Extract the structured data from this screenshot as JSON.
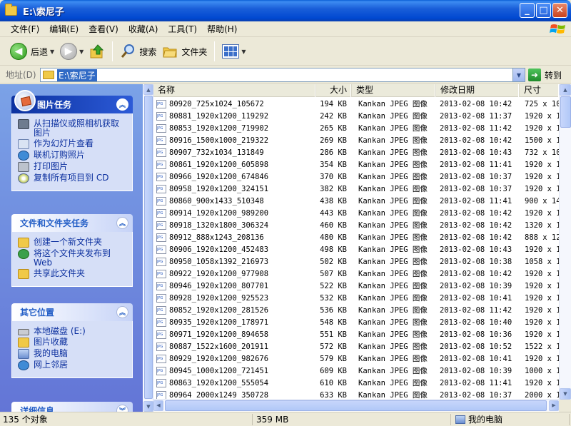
{
  "window": {
    "title": "E:\\索尼子"
  },
  "menu": [
    "文件(F)",
    "编辑(E)",
    "查看(V)",
    "收藏(A)",
    "工具(T)",
    "帮助(H)"
  ],
  "toolbar": {
    "back_label": "后退",
    "search_label": "搜索",
    "folders_label": "文件夹"
  },
  "address": {
    "label": "地址(D)",
    "path": "E:\\索尼子",
    "go_label": "转到"
  },
  "taskpane": {
    "picture_tasks": {
      "title": "图片任务",
      "items": [
        "从扫描仪或照相机获取图片",
        "作为幻灯片查看",
        "联机订购照片",
        "打印图片",
        "复制所有项目到 CD"
      ]
    },
    "file_tasks": {
      "title": "文件和文件夹任务",
      "items": [
        "创建一个新文件夹",
        "将这个文件夹发布到 Web",
        "共享此文件夹"
      ]
    },
    "other_places": {
      "title": "其它位置",
      "items": [
        "本地磁盘 (E:)",
        "图片收藏",
        "我的电脑",
        "网上邻居"
      ]
    },
    "details": {
      "title": "详细信息"
    }
  },
  "columns": {
    "name": "名称",
    "size": "大小",
    "type": "类型",
    "date": "修改日期",
    "dim": "尺寸"
  },
  "files": [
    {
      "name": "80920_725x1024_105672",
      "size": "194 KB",
      "type": "Kankan JPEG 图像",
      "date": "2013-02-08 10:42",
      "dim": "725 x 10"
    },
    {
      "name": "80881_1920x1200_119292",
      "size": "242 KB",
      "type": "Kankan JPEG 图像",
      "date": "2013-02-08 11:37",
      "dim": "1920 x 1"
    },
    {
      "name": "80853_1920x1200_719902",
      "size": "265 KB",
      "type": "Kankan JPEG 图像",
      "date": "2013-02-08 11:42",
      "dim": "1920 x 1"
    },
    {
      "name": "80916_1500x1000_219322",
      "size": "269 KB",
      "type": "Kankan JPEG 图像",
      "date": "2013-02-08 10:42",
      "dim": "1500 x 1"
    },
    {
      "name": "80907_732x1034_131849",
      "size": "286 KB",
      "type": "Kankan JPEG 图像",
      "date": "2013-02-08 10:43",
      "dim": "732 x 10"
    },
    {
      "name": "80861_1920x1200_605898",
      "size": "354 KB",
      "type": "Kankan JPEG 图像",
      "date": "2013-02-08 11:41",
      "dim": "1920 x 1"
    },
    {
      "name": "80966_1920x1200_674846",
      "size": "370 KB",
      "type": "Kankan JPEG 图像",
      "date": "2013-02-08 10:37",
      "dim": "1920 x 1"
    },
    {
      "name": "80958_1920x1200_324151",
      "size": "382 KB",
      "type": "Kankan JPEG 图像",
      "date": "2013-02-08 10:37",
      "dim": "1920 x 1"
    },
    {
      "name": "80860_900x1433_510348",
      "size": "438 KB",
      "type": "Kankan JPEG 图像",
      "date": "2013-02-08 11:41",
      "dim": "900 x 14"
    },
    {
      "name": "80914_1920x1200_989200",
      "size": "443 KB",
      "type": "Kankan JPEG 图像",
      "date": "2013-02-08 10:42",
      "dim": "1920 x 1"
    },
    {
      "name": "80918_1320x1800_306324",
      "size": "460 KB",
      "type": "Kankan JPEG 图像",
      "date": "2013-02-08 10:42",
      "dim": "1320 x 1"
    },
    {
      "name": "80912_888x1243_208136",
      "size": "480 KB",
      "type": "Kankan JPEG 图像",
      "date": "2013-02-08 10:42",
      "dim": "888 x 12"
    },
    {
      "name": "80906_1920x1200_452483",
      "size": "498 KB",
      "type": "Kankan JPEG 图像",
      "date": "2013-02-08 10:43",
      "dim": "1920 x 1"
    },
    {
      "name": "80950_1058x1392_216973",
      "size": "502 KB",
      "type": "Kankan JPEG 图像",
      "date": "2013-02-08 10:38",
      "dim": "1058 x 1"
    },
    {
      "name": "80922_1920x1200_977908",
      "size": "507 KB",
      "type": "Kankan JPEG 图像",
      "date": "2013-02-08 10:42",
      "dim": "1920 x 1"
    },
    {
      "name": "80946_1920x1200_807701",
      "size": "522 KB",
      "type": "Kankan JPEG 图像",
      "date": "2013-02-08 10:39",
      "dim": "1920 x 1"
    },
    {
      "name": "80928_1920x1200_925523",
      "size": "532 KB",
      "type": "Kankan JPEG 图像",
      "date": "2013-02-08 10:41",
      "dim": "1920 x 1"
    },
    {
      "name": "80852_1920x1200_281526",
      "size": "536 KB",
      "type": "Kankan JPEG 图像",
      "date": "2013-02-08 11:42",
      "dim": "1920 x 1"
    },
    {
      "name": "80935_1920x1200_178971",
      "size": "548 KB",
      "type": "Kankan JPEG 图像",
      "date": "2013-02-08 10:40",
      "dim": "1920 x 1"
    },
    {
      "name": "80971_1920x1200_894658",
      "size": "551 KB",
      "type": "Kankan JPEG 图像",
      "date": "2013-02-08 10:36",
      "dim": "1920 x 1"
    },
    {
      "name": "80887_1522x1600_201911",
      "size": "572 KB",
      "type": "Kankan JPEG 图像",
      "date": "2013-02-08 10:52",
      "dim": "1522 x 1"
    },
    {
      "name": "80929_1920x1200_982676",
      "size": "579 KB",
      "type": "Kankan JPEG 图像",
      "date": "2013-02-08 10:41",
      "dim": "1920 x 1"
    },
    {
      "name": "80945_1000x1200_721451",
      "size": "609 KB",
      "type": "Kankan JPEG 图像",
      "date": "2013-02-08 10:39",
      "dim": "1000 x 1"
    },
    {
      "name": "80863_1920x1200_555054",
      "size": "610 KB",
      "type": "Kankan JPEG 图像",
      "date": "2013-02-08 11:41",
      "dim": "1920 x 1"
    },
    {
      "name": "80964_2000x1249_350728",
      "size": "633 KB",
      "type": "Kankan JPEG 图像",
      "date": "2013-02-08 10:37",
      "dim": "2000 x 1"
    }
  ],
  "status": {
    "count": "135 个对象",
    "size": "359 MB",
    "location": "我的电脑"
  },
  "colors": {
    "title_bar": "#0048d1",
    "task_pane": "#6375d6",
    "selection": "#316ac5"
  }
}
